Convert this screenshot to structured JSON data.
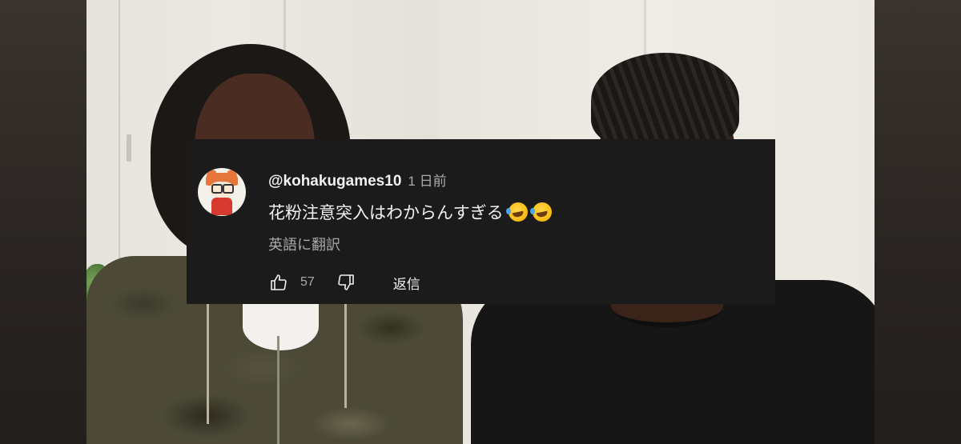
{
  "comment": {
    "username": "@kohakugames10",
    "timestamp": "1 日前",
    "text": "花粉注意突入はわからんすぎる",
    "emojis": [
      "rolling-on-floor-laughing-emoji",
      "rolling-on-floor-laughing-emoji"
    ],
    "translate_label": "英語に翻訳",
    "like_count": "57",
    "reply_label": "返信"
  },
  "colors": {
    "card_background": "#1b1b1b",
    "primary_text": "#f1f1f1",
    "secondary_text": "#aaaaaa"
  },
  "icons": {
    "like": "thumbs-up-icon",
    "dislike": "thumbs-down-icon"
  }
}
